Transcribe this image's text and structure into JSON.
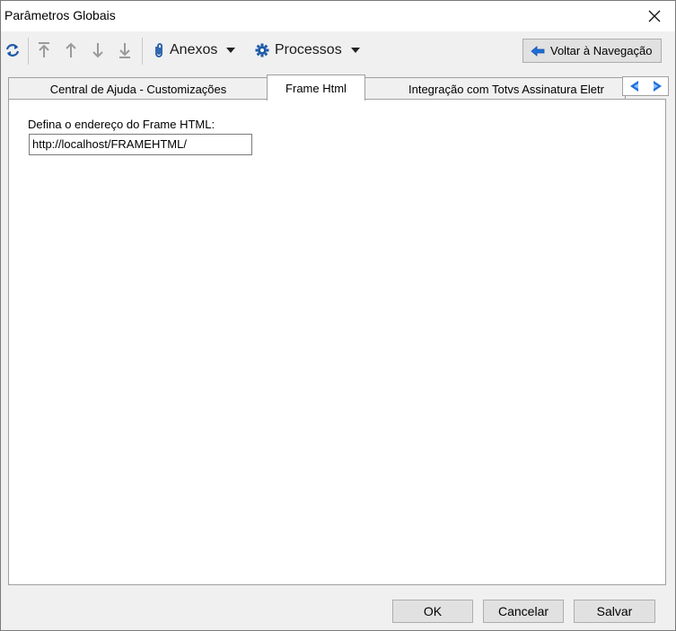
{
  "window": {
    "title": "Parâmetros Globais"
  },
  "toolbar": {
    "icons": [
      "refresh-icon",
      "move-first-icon",
      "move-up-icon",
      "move-down-icon",
      "move-last-icon"
    ],
    "anexos_label": "Anexos",
    "processos_label": "Processos",
    "back_label": "Voltar à Navegação"
  },
  "tabs": [
    {
      "label": "Central de Ajuda - Customizações"
    },
    {
      "label": "Frame Html"
    },
    {
      "label": "Integração com Totvs Assinatura Eletr"
    }
  ],
  "active_tab": "Frame Html",
  "form": {
    "frame_label": "Defina o endereço do Frame HTML:",
    "frame_value": "http://localhost/FRAMEHTML/"
  },
  "footer": {
    "ok": "OK",
    "cancel": "Cancelar",
    "save": "Salvar"
  },
  "colors": {
    "accent_blue": "#1e6fd9",
    "icon_gray": "#9a9a9a",
    "icon_blue": "#1e5aa8"
  }
}
